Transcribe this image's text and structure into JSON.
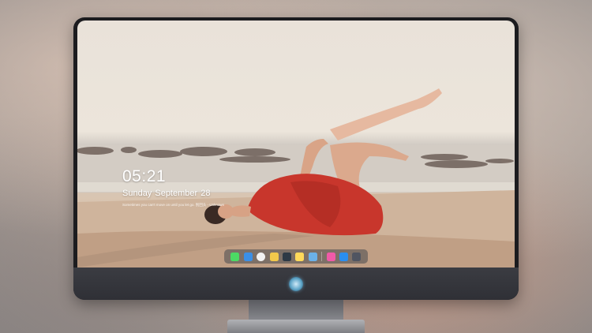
{
  "lock_screen": {
    "time": "05:21",
    "date": "Sunday September  28",
    "quote": "Sometimes you can't move on until you let go. 别回头 - Unknown"
  },
  "dock": {
    "items": [
      {
        "name": "messages-icon",
        "color": "#4cd964"
      },
      {
        "name": "files-icon",
        "color": "#3b8fe6"
      },
      {
        "name": "safari-icon",
        "color": "#f2f2f2"
      },
      {
        "name": "notes-board-icon",
        "color": "#f2c84b"
      },
      {
        "name": "video-clapper-icon",
        "color": "#2e3a46"
      },
      {
        "name": "notes-icon",
        "color": "#ffd95a"
      },
      {
        "name": "preview-icon",
        "color": "#6bb1e8"
      },
      {
        "name": "music-icon",
        "color": "#f05aa8"
      },
      {
        "name": "app-store-icon",
        "color": "#2a8ef0"
      },
      {
        "name": "camera-icon",
        "color": "#505561"
      }
    ]
  },
  "colors": {
    "bezel": "#1c1c1f",
    "dress": "#c8362c",
    "sky": "#ece5db",
    "sand": "#c8ab92"
  }
}
